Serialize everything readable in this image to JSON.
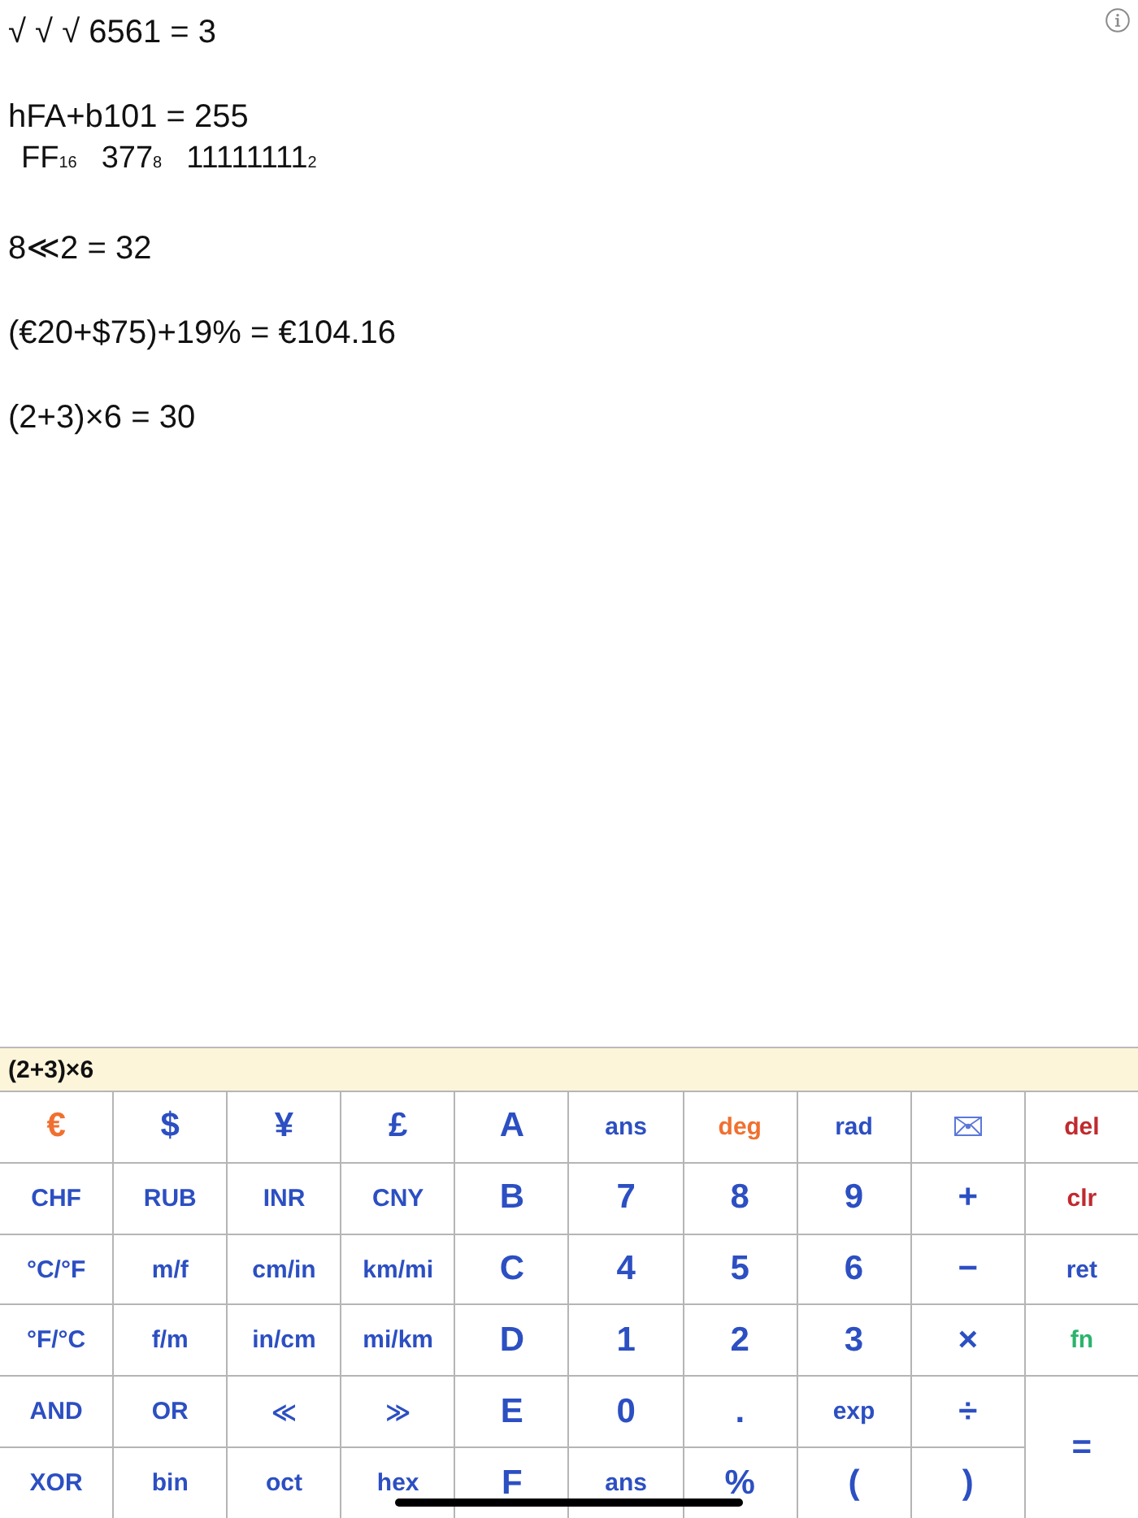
{
  "history": [
    {
      "expression": "√ √ √ 6561 = 3"
    },
    {
      "expression": "hFA+b101 = 255",
      "conversions": [
        "FF$_{16}$",
        "377$_{8}$",
        "11111111$_{2}$"
      ]
    },
    {
      "expression": "8≪2 = 32"
    },
    {
      "expression": "(€20+$75)+19% = €104.16"
    },
    {
      "expression": "(2+3)×6 = 30"
    }
  ],
  "input": {
    "value": "(2+3)×6"
  },
  "keypad": {
    "keys": [
      {
        "label": "€",
        "kind": "symbol",
        "color": "#f07030"
      },
      {
        "label": "$",
        "kind": "symbol",
        "color": "#2c4fc2"
      },
      {
        "label": "¥",
        "kind": "symbol",
        "color": "#2c4fc2"
      },
      {
        "label": "£",
        "kind": "symbol",
        "color": "#2c4fc2"
      },
      {
        "label": "A",
        "kind": "symbol",
        "color": "#2c4fc2"
      },
      {
        "label": "ans",
        "kind": "word",
        "color": "#2c4fc2"
      },
      {
        "label": "deg",
        "kind": "word",
        "color": "#f07030"
      },
      {
        "label": "rad",
        "kind": "word",
        "color": "#2c4fc2"
      },
      {
        "kind": "icon",
        "color": "#5b78d8"
      },
      {
        "label": "del",
        "kind": "word",
        "color": "#c02a2e"
      },
      {
        "label": "CHF",
        "kind": "word",
        "color": "#2c4fc2"
      },
      {
        "label": "RUB",
        "kind": "word",
        "color": "#2c4fc2"
      },
      {
        "label": "INR",
        "kind": "word",
        "color": "#2c4fc2"
      },
      {
        "label": "CNY",
        "kind": "word",
        "color": "#2c4fc2"
      },
      {
        "label": "B",
        "kind": "symbol",
        "color": "#2c4fc2"
      },
      {
        "label": "7",
        "kind": "symbol",
        "color": "#2c4fc2"
      },
      {
        "label": "8",
        "kind": "symbol",
        "color": "#2c4fc2"
      },
      {
        "label": "9",
        "kind": "symbol",
        "color": "#2c4fc2"
      },
      {
        "label": "+",
        "kind": "symbol",
        "color": "#2c4fc2"
      },
      {
        "label": "clr",
        "kind": "word",
        "color": "#c02a2e"
      },
      {
        "label": "°C/°F",
        "kind": "word",
        "color": "#2c4fc2"
      },
      {
        "label": "m/f",
        "kind": "word",
        "color": "#2c4fc2"
      },
      {
        "label": "cm/in",
        "kind": "word",
        "color": "#2c4fc2"
      },
      {
        "label": "km/mi",
        "kind": "word",
        "color": "#2c4fc2"
      },
      {
        "label": "C",
        "kind": "symbol",
        "color": "#2c4fc2"
      },
      {
        "label": "4",
        "kind": "symbol",
        "color": "#2c4fc2"
      },
      {
        "label": "5",
        "kind": "symbol",
        "color": "#2c4fc2"
      },
      {
        "label": "6",
        "kind": "symbol",
        "color": "#2c4fc2"
      },
      {
        "label": "−",
        "kind": "symbol",
        "color": "#2c4fc2"
      },
      {
        "label": "ret",
        "kind": "word",
        "color": "#2c4fc2"
      },
      {
        "label": "°F/°C",
        "kind": "word",
        "color": "#2c4fc2"
      },
      {
        "label": "f/m",
        "kind": "word",
        "color": "#2c4fc2"
      },
      {
        "label": "in/cm",
        "kind": "word",
        "color": "#2c4fc2"
      },
      {
        "label": "mi/km",
        "kind": "word",
        "color": "#2c4fc2"
      },
      {
        "label": "D",
        "kind": "symbol",
        "color": "#2c4fc2"
      },
      {
        "label": "1",
        "kind": "symbol",
        "color": "#2c4fc2"
      },
      {
        "label": "2",
        "kind": "symbol",
        "color": "#2c4fc2"
      },
      {
        "label": "3",
        "kind": "symbol",
        "color": "#2c4fc2"
      },
      {
        "label": "×",
        "kind": "symbol",
        "color": "#2c4fc2"
      },
      {
        "label": "fn",
        "kind": "word",
        "color": "#2bb36c"
      },
      {
        "label": "AND",
        "kind": "word",
        "color": "#2c4fc2"
      },
      {
        "label": "OR",
        "kind": "word",
        "color": "#2c4fc2"
      },
      {
        "label": "≪",
        "kind": "word",
        "color": "#2c4fc2"
      },
      {
        "label": "≫",
        "kind": "word",
        "color": "#2c4fc2"
      },
      {
        "label": "E",
        "kind": "symbol",
        "color": "#2c4fc2"
      },
      {
        "label": "0",
        "kind": "symbol",
        "color": "#2c4fc2"
      },
      {
        "label": ".",
        "kind": "symbol",
        "color": "#2c4fc2"
      },
      {
        "label": "exp",
        "kind": "word",
        "color": "#2c4fc2"
      },
      {
        "label": "÷",
        "kind": "symbol",
        "color": "#2c4fc2"
      },
      {
        "label": "=",
        "kind": "tall",
        "color": "#2c4fc2"
      },
      {
        "label": "XOR",
        "kind": "word",
        "color": "#2c4fc2"
      },
      {
        "label": "bin",
        "kind": "word",
        "color": "#2c4fc2"
      },
      {
        "label": "oct",
        "kind": "word",
        "color": "#2c4fc2"
      },
      {
        "label": "hex",
        "kind": "word",
        "color": "#2c4fc2"
      },
      {
        "label": "F",
        "kind": "symbol",
        "color": "#2c4fc2"
      },
      {
        "label": "ans",
        "kind": "word",
        "color": "#2c4fc2"
      },
      {
        "label": "%",
        "kind": "symbol",
        "color": "#2c4fc2"
      },
      {
        "label": "(",
        "kind": "symbol",
        "color": "#2c4fc2"
      },
      {
        "label": ")",
        "kind": "symbol",
        "color": "#2c4fc2"
      }
    ]
  }
}
